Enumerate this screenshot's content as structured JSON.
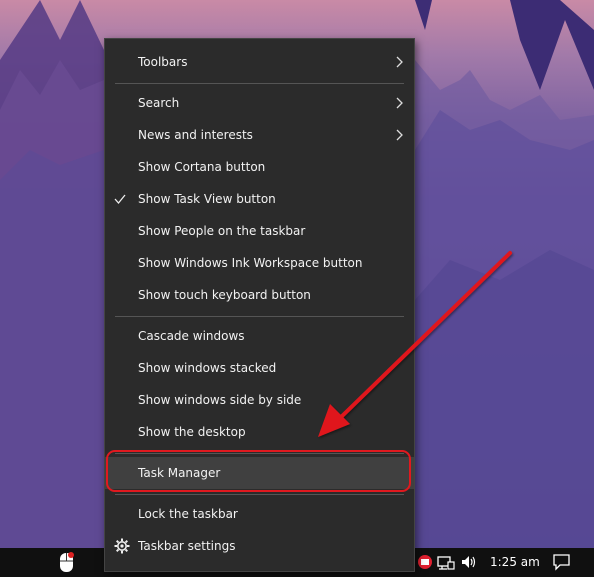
{
  "menu": {
    "items": [
      {
        "label": "Toolbars",
        "submenu": true
      },
      {
        "label": "Search",
        "submenu": true
      },
      {
        "label": "News and interests",
        "submenu": true
      },
      {
        "label": "Show Cortana button"
      },
      {
        "label": "Show Task View button",
        "checked": true
      },
      {
        "label": "Show People on the taskbar"
      },
      {
        "label": "Show Windows Ink Workspace button"
      },
      {
        "label": "Show touch keyboard button"
      },
      {
        "label": "Cascade windows"
      },
      {
        "label": "Show windows stacked"
      },
      {
        "label": "Show windows side by side"
      },
      {
        "label": "Show the desktop"
      },
      {
        "label": "Task Manager",
        "highlighted": true
      },
      {
        "label": "Lock the taskbar"
      },
      {
        "label": "Taskbar settings",
        "icon": "gear-icon"
      }
    ]
  },
  "annotation": {
    "color": "#e0191f",
    "target": "Task Manager"
  },
  "taskbar": {
    "time": "1:25 am",
    "icons": [
      "mouse-icon",
      "notification-badge-icon",
      "network-icon",
      "volume-icon",
      "action-center-icon"
    ]
  }
}
